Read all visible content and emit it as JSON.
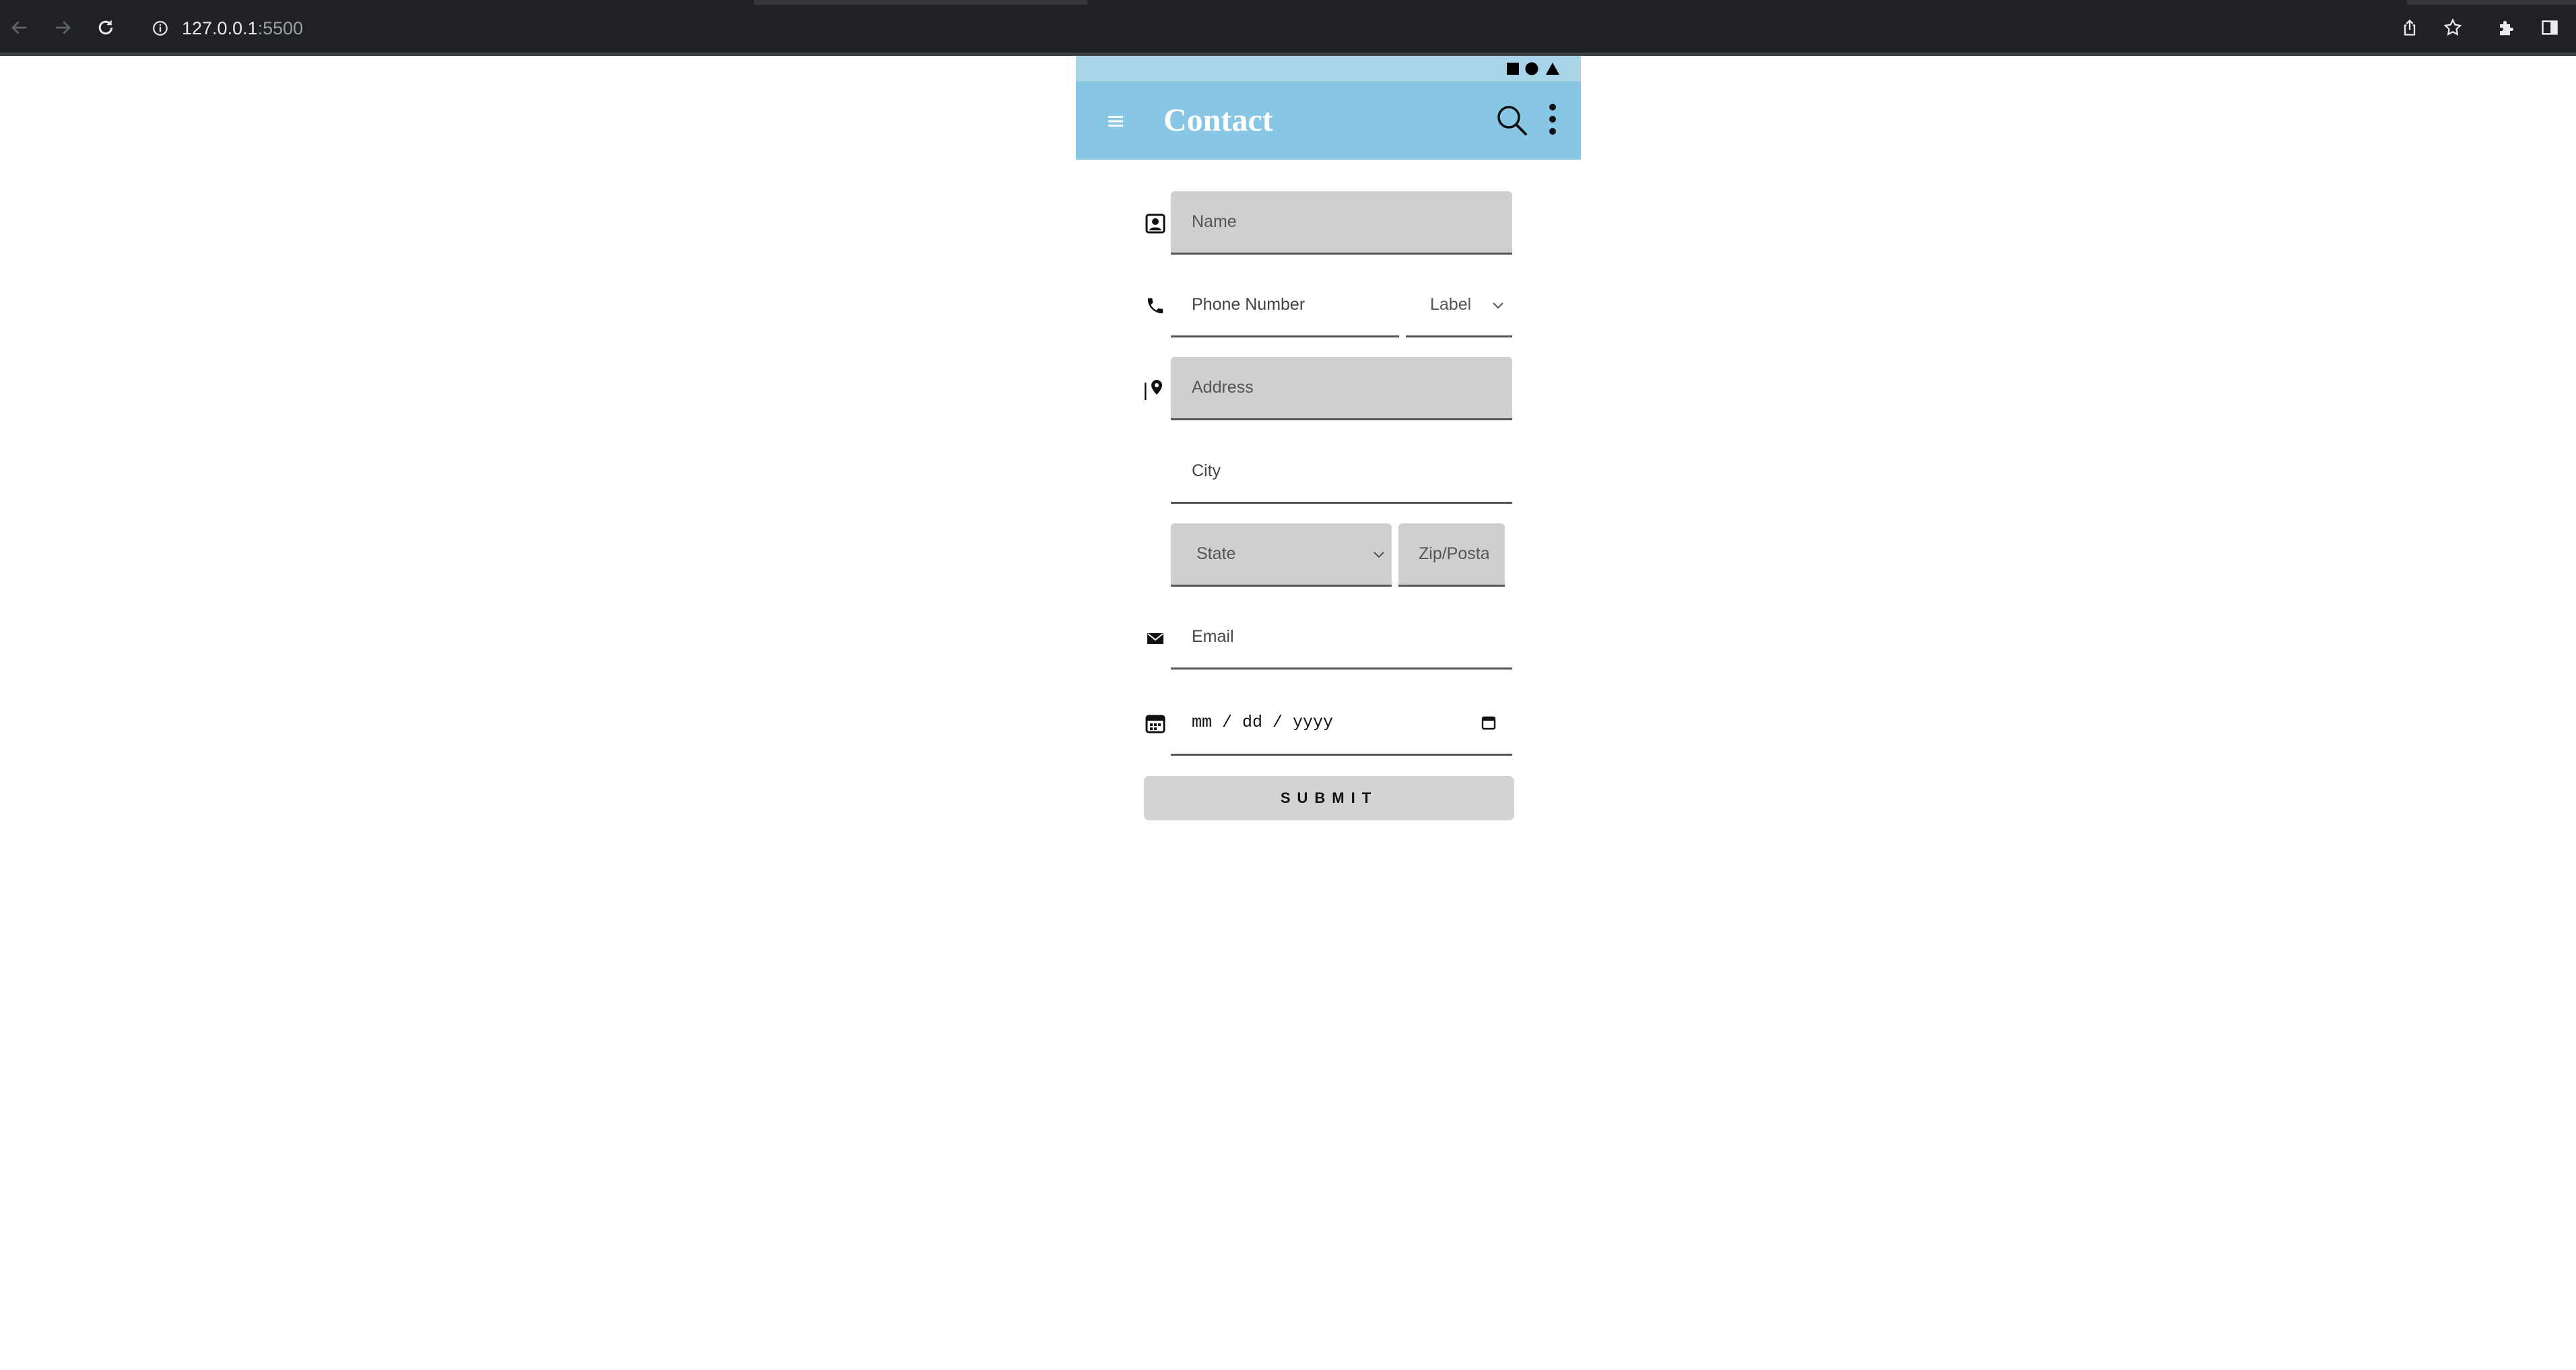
{
  "browser": {
    "url_host": "127.0.0.1",
    "url_port": ":5500"
  },
  "app": {
    "title": "Contact",
    "accent_color": "#87c6e5",
    "statusbar_color": "#a9d3e6",
    "statusbar_icons": [
      "square-icon",
      "circle-icon",
      "triangle-icon"
    ]
  },
  "form": {
    "name_placeholder": "Name",
    "phone_placeholder": "Phone Number",
    "phone_label_select": "Label",
    "address_placeholder": "Address",
    "city_placeholder": "City",
    "state_select": "State",
    "zip_placeholder": "Zip/Postal",
    "email_placeholder": "Email",
    "date_value": "mm / dd / yyyy",
    "submit_label": "SUBMIT"
  }
}
